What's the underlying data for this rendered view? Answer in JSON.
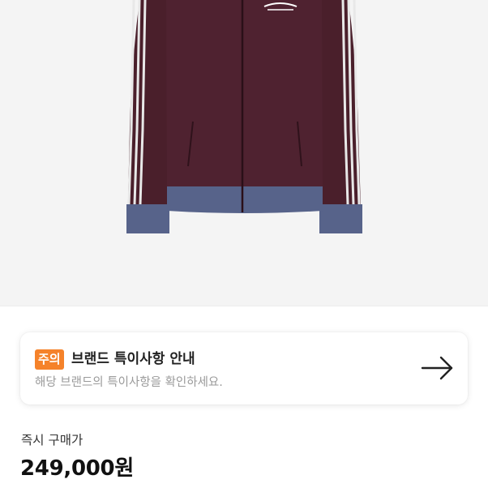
{
  "product": {
    "image_icon": "track-jacket-product-photo",
    "colors": {
      "body": "#4a1f2b",
      "cuff": "#57638a",
      "stripe": "#e8e8e8",
      "background": "#f4f4f4"
    }
  },
  "notice": {
    "badge": "주의",
    "title": "브랜드 특이사항 안내",
    "description": "해당 브랜드의 특이사항을 확인하세요.",
    "arrow_icon": "arrow-right-icon",
    "badge_color": "#f5822a"
  },
  "price": {
    "label": "즉시 구매가",
    "value": "249,000원"
  }
}
